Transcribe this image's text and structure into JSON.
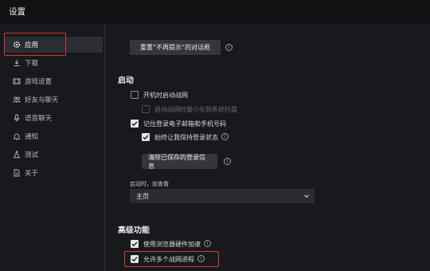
{
  "window": {
    "title": "设置"
  },
  "sidebar": {
    "items": [
      {
        "label": "应用",
        "icon": "gear-icon"
      },
      {
        "label": "下载",
        "icon": "download-icon"
      },
      {
        "label": "游戏设置",
        "icon": "game-settings-icon"
      },
      {
        "label": "好友与聊天",
        "icon": "friends-icon"
      },
      {
        "label": "语音聊天",
        "icon": "microphone-icon"
      },
      {
        "label": "通知",
        "icon": "bell-icon"
      },
      {
        "label": "测试",
        "icon": "flask-icon"
      },
      {
        "label": "关于",
        "icon": "document-icon"
      }
    ],
    "active_index": 0
  },
  "main": {
    "reset_dialogs_button": "重置“不再提示”的对话框",
    "startup": {
      "title": "启动",
      "launch_on_boot": {
        "label": "开机时启动战网",
        "checked": false
      },
      "minimize_on_boot": {
        "label": "启动战网时最小化到系统托盘",
        "checked": false,
        "disabled": true
      },
      "remember_email": {
        "label": "记住登录电子邮箱和手机号码",
        "checked": true
      },
      "keep_logged_in": {
        "label": "始终让我保持登录状态",
        "checked": true
      },
      "clear_login_button": "清除已保存的登录信息",
      "on_launch_label": "启动时，前查看",
      "on_launch_value": "主页"
    },
    "advanced": {
      "title": "高级功能",
      "hw_accel": {
        "label": "使用浏览器硬件加速",
        "checked": true
      },
      "multi_instance": {
        "label": "允许多个战网进程",
        "checked": true
      }
    }
  },
  "colors": {
    "background": "#18191d",
    "highlight_box": "#d9382f"
  }
}
